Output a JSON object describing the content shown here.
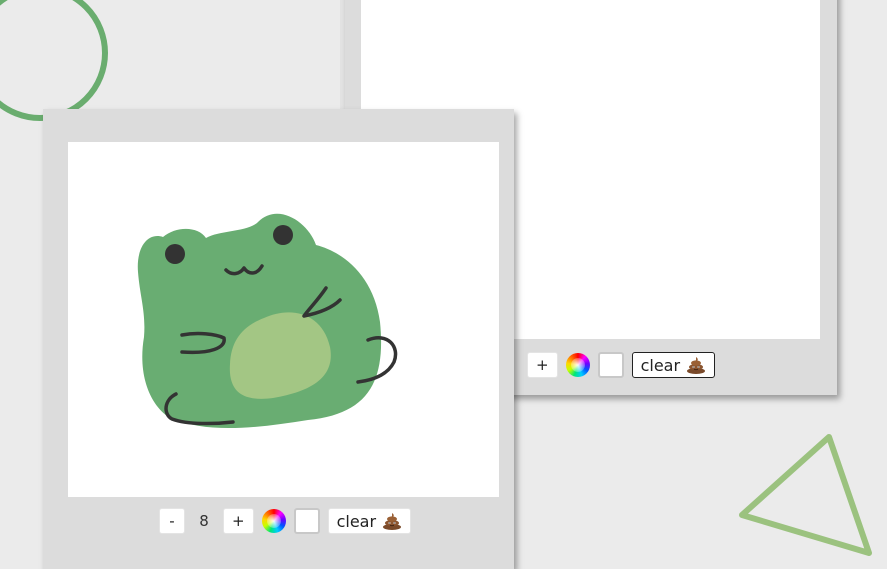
{
  "back_panel": {
    "toolbar": {
      "increase_label": "+",
      "clear_label": "clear",
      "color_value": "#ffffff"
    }
  },
  "front_panel": {
    "toolbar": {
      "decrease_label": "-",
      "brush_size": "8",
      "increase_label": "+",
      "clear_label": "clear",
      "color_value": "#ffffff"
    },
    "drawing": {
      "subject": "frog"
    }
  },
  "colors": {
    "background": "#ebebeb",
    "panel": "#dcdcdc",
    "frog_green": "#69ad72",
    "frog_belly": "#a3c684",
    "stroke": "#333333",
    "deco_circle": "#6aad6f",
    "deco_triangle": "#9bc27f"
  },
  "icons": {
    "color_wheel": "color-wheel-icon",
    "clear": "poop-icon"
  }
}
